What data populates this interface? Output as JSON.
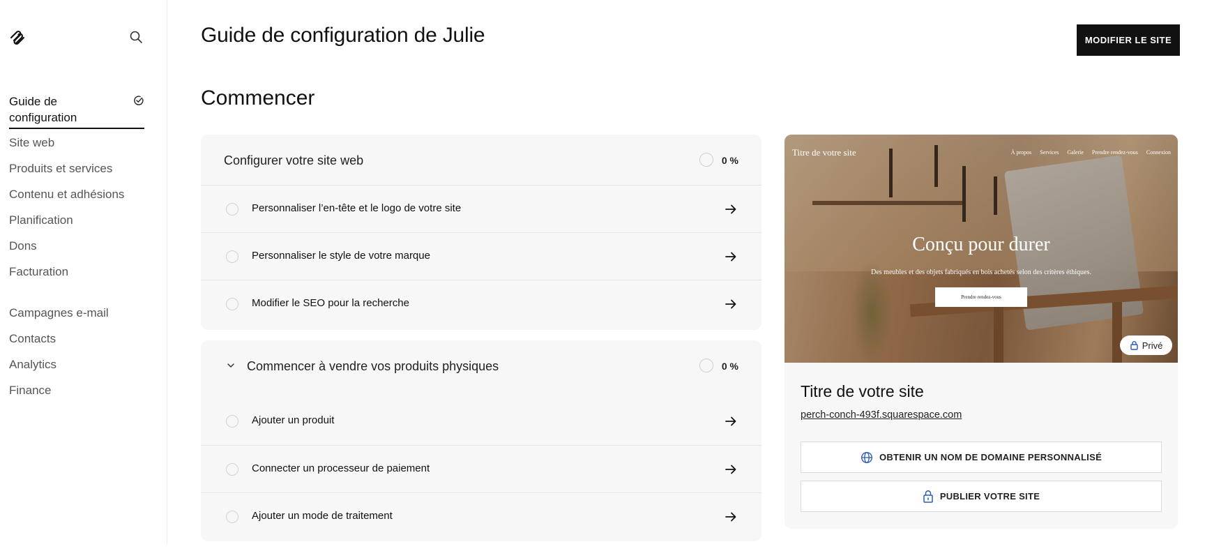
{
  "sidebar": {
    "active_item": "Guide de configuration",
    "items": [
      "Site web",
      "Produits et services",
      "Contenu et adhésions",
      "Planification",
      "Dons",
      "Facturation",
      "Campagnes e-mail",
      "Contacts",
      "Analytics",
      "Finance"
    ]
  },
  "header": {
    "title": "Guide de configuration de Julie",
    "edit_button": "MODIFIER LE SITE"
  },
  "main": {
    "section_title": "Commencer",
    "cards": [
      {
        "title": "Configurer votre site web",
        "progress": "0 %",
        "tasks": [
          "Personnaliser l’en-tête et le logo de votre site",
          "Personnaliser le style de votre marque",
          "Modifier le SEO pour la recherche"
        ]
      },
      {
        "title": "Commencer à vendre vos produits physiques",
        "progress": "0 %",
        "tasks": [
          "Ajouter un produit",
          "Connecter un processeur de paiement",
          "Ajouter un mode de traitement"
        ]
      }
    ]
  },
  "preview": {
    "hero": {
      "site_name": "Titre de votre site",
      "nav": [
        "À propos",
        "Services",
        "Galerie",
        "Prendre rendez-vous",
        "Connexion"
      ],
      "headline": "Conçu pour durer",
      "subtext": "Des meubles et des objets fabriqués en bois achetés selon des critères éthiques.",
      "cta": "Prendre rendez-vous",
      "badge": "Privé"
    },
    "site_title": "Titre de votre site",
    "site_url": "perch-conch-493f.squarespace.com",
    "domain_button": "OBTENIR UN NOM DE DOMAINE PERSONNALISÉ",
    "publish_button": "PUBLIER VOTRE SITE"
  },
  "colors": {
    "accent": "#111111",
    "link_icon_blue": "#2b5cb8",
    "card_bg": "#f7f7f7"
  }
}
